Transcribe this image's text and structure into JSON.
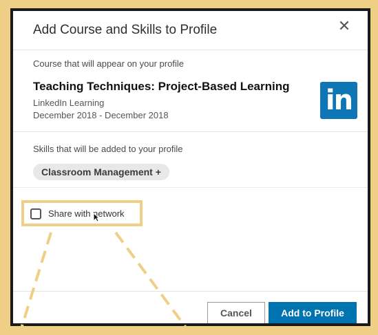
{
  "dialog": {
    "title": "Add Course and Skills to Profile",
    "close_glyph": "✕"
  },
  "course": {
    "section_label": "Course that will appear on your profile",
    "title": "Teaching Techniques: Project-Based Learning",
    "provider": "LinkedIn Learning",
    "dates": "December 2018 - December 2018",
    "logo_text": "in"
  },
  "skills": {
    "section_label": "Skills that will be added to your profile",
    "items": [
      "Classroom Management +"
    ]
  },
  "share": {
    "label": "Share with network",
    "checked": false
  },
  "footer": {
    "cancel_label": "Cancel",
    "add_label": "Add to Profile"
  },
  "colors": {
    "frame": "#efcf86",
    "linkedin_blue": "#0e76b5",
    "primary_button": "#0073b1"
  }
}
